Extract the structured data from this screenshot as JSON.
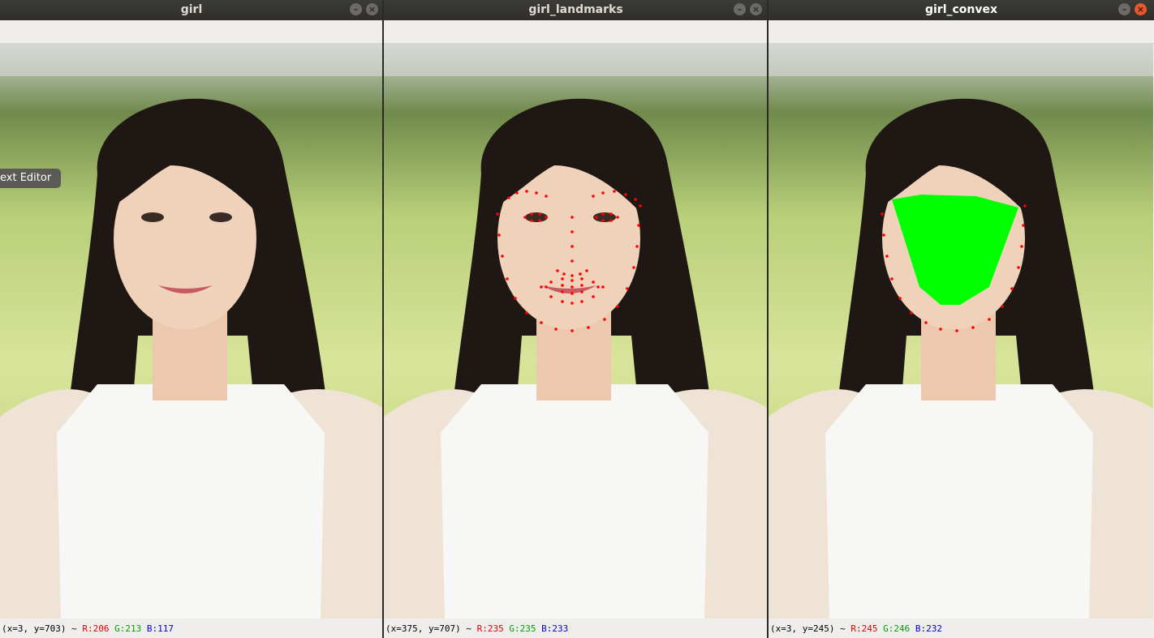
{
  "windows": [
    {
      "title": "girl",
      "active": false,
      "status": {
        "coords": "(x=3, y=703) ~ ",
        "r": "R:206",
        "g": "G:213",
        "b": "B:117"
      },
      "tooltip": "ext Editor",
      "buttons": [
        "–",
        "×"
      ]
    },
    {
      "title": "girl_landmarks",
      "active": false,
      "status": {
        "coords": "(x=375, y=707) ~ ",
        "r": "R:235",
        "g": "G:235",
        "b": "B:233"
      },
      "buttons": [
        "–",
        "×"
      ]
    },
    {
      "title": "girl_convex",
      "active": true,
      "status": {
        "coords": "(x=3, y=245) ~ ",
        "r": "R:245",
        "g": "G:246",
        "b": "B:232"
      },
      "buttons": [
        "–",
        "×"
      ]
    }
  ],
  "colors": {
    "landmark": "#ff0000",
    "hull": "#00ff00",
    "titlebar": "#3c3b37"
  },
  "icons": {
    "minimize": "minimize-icon",
    "close": "close-icon"
  }
}
